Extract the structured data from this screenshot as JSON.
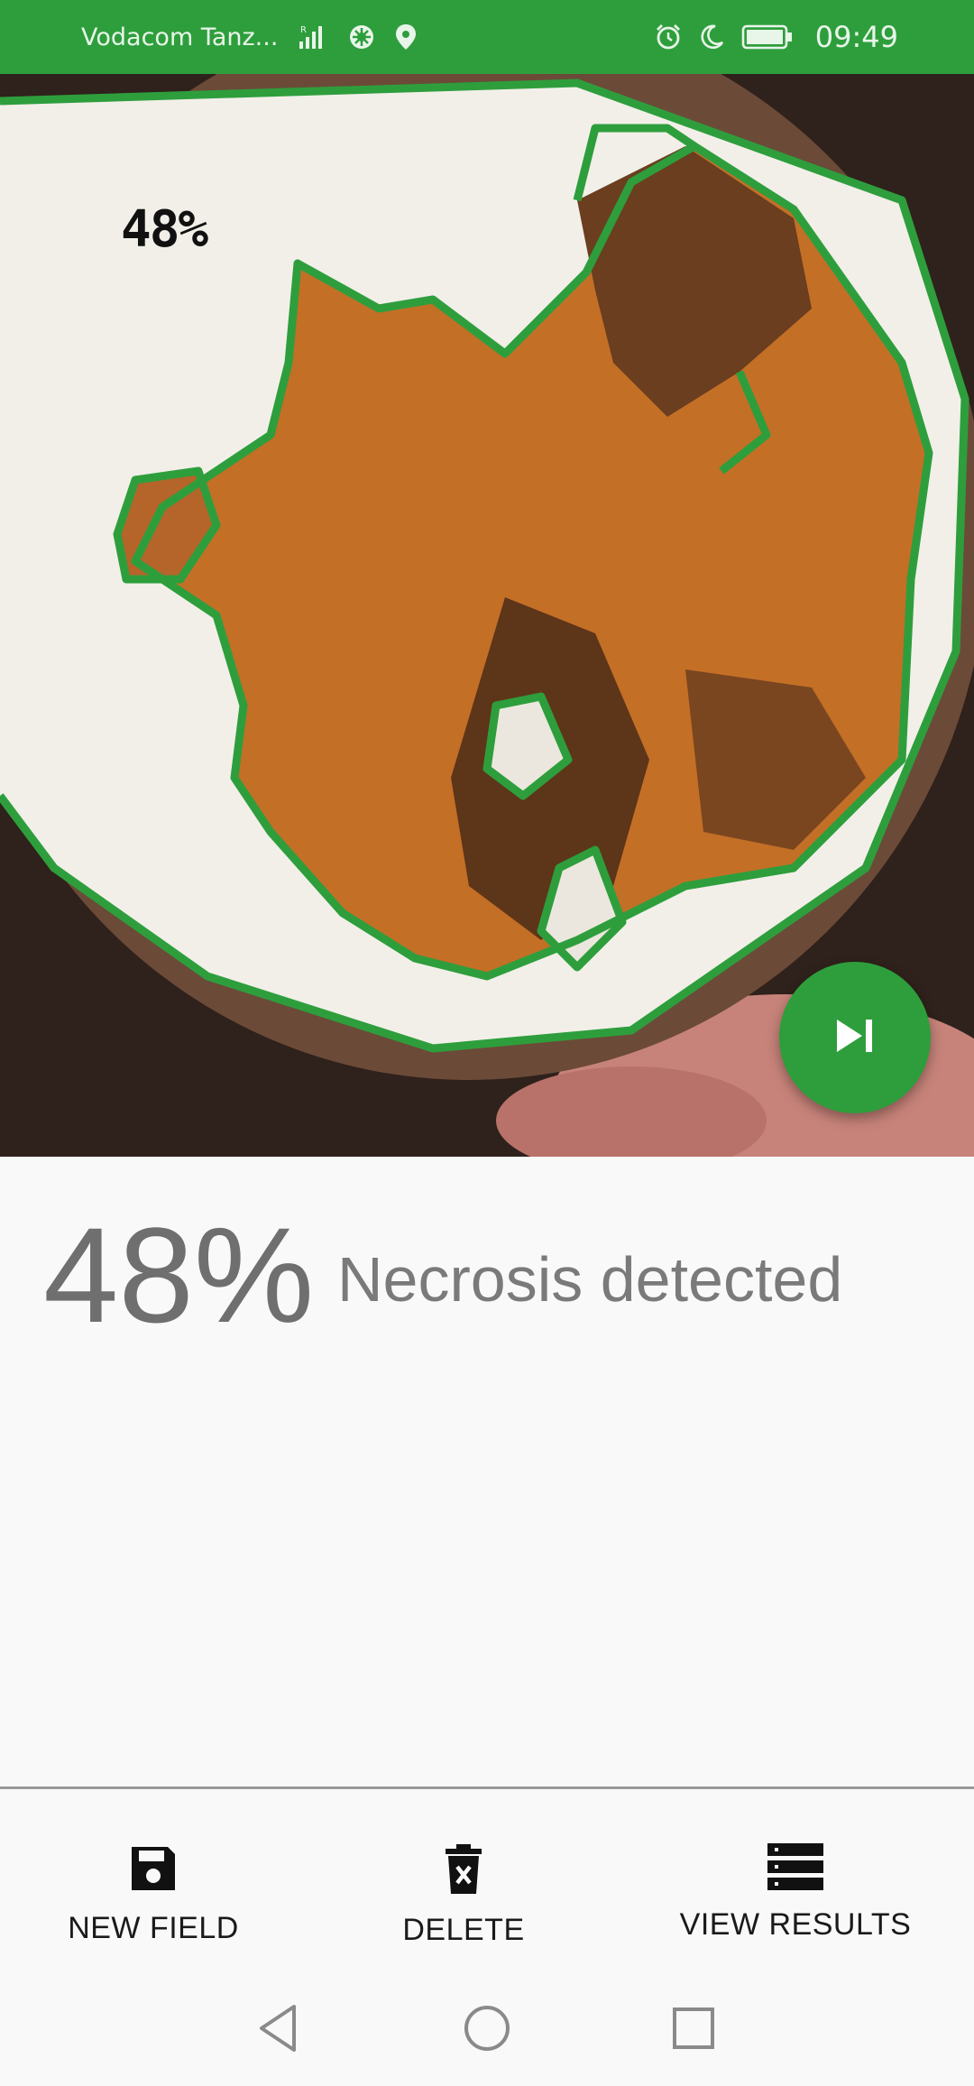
{
  "status_bar": {
    "carrier": "Vodacom Tanz...",
    "time": "09:49",
    "background_color": "#2e9e3c",
    "icons": [
      "signal-icon",
      "data-icon",
      "location-icon",
      "alarm-icon",
      "moon-icon",
      "battery-icon"
    ]
  },
  "photo": {
    "overlay_percent": "48%",
    "outline_color": "#2e9e3c"
  },
  "fab": {
    "icon": "skip-next-icon",
    "color": "#2e9e3c"
  },
  "result": {
    "percent": "48%",
    "label": "Necrosis detected"
  },
  "actions": {
    "new_field": {
      "label": "NEW FIELD",
      "icon": "save-icon"
    },
    "delete": {
      "label": "DELETE",
      "icon": "trash-icon"
    },
    "view_results": {
      "label": "VIEW RESULTS",
      "icon": "list-icon"
    }
  },
  "nav": {
    "icons": [
      "back-icon",
      "home-icon",
      "recents-icon"
    ]
  }
}
